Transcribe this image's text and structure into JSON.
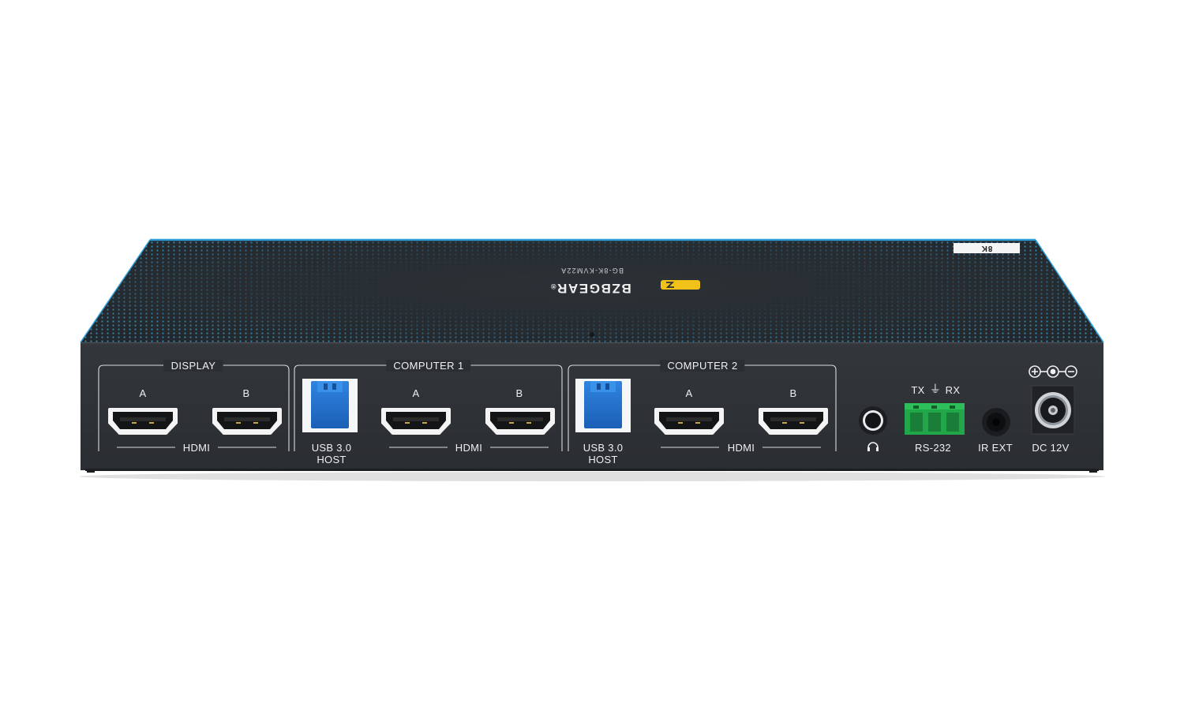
{
  "product": {
    "brand_prefix": "BZB",
    "brand_suffix": "GEAR",
    "brand_registered": "®",
    "model": "BG-8K-KVM22A",
    "badge": "8K",
    "colors": {
      "chassis": "#2d3034",
      "chassis_top": "#2a2e33",
      "accent_blue": "#2f9fd8",
      "usb_blue": "#1d6fd1",
      "terminal_green": "#22a64a",
      "logo_yellow": "#f2c21b"
    }
  },
  "panel": {
    "display_group": {
      "title": "DISPLAY",
      "port_a": "A",
      "port_b": "B",
      "type": "HDMI"
    },
    "computer1_group": {
      "title": "COMPUTER 1",
      "usb_line1": "USB 3.0",
      "usb_line2": "HOST",
      "port_a": "A",
      "port_b": "B",
      "type": "HDMI"
    },
    "computer2_group": {
      "title": "COMPUTER 2",
      "usb_line1": "USB 3.0",
      "usb_line2": "HOST",
      "port_a": "A",
      "port_b": "B",
      "type": "HDMI"
    },
    "rs232": {
      "tx": "TX",
      "ground": "⏚",
      "rx": "RX",
      "label": "RS-232"
    },
    "headphone_icon": "headphones-icon",
    "ir_label": "IR EXT",
    "dc_label": "DC 12V",
    "polarity_icon": "dc-polarity-icon"
  }
}
